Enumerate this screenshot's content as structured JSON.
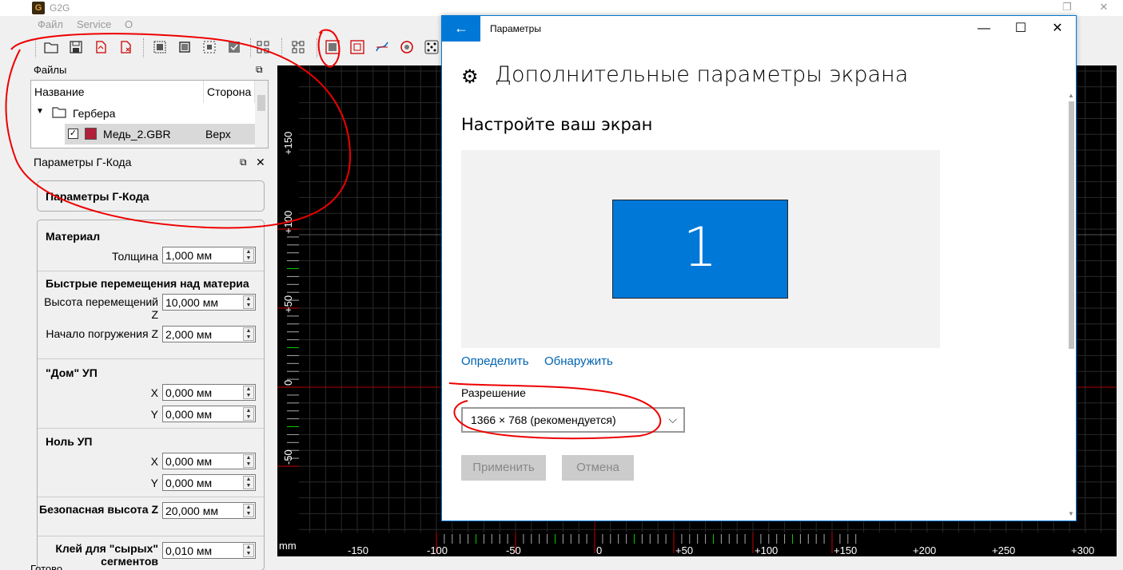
{
  "g2g": {
    "title": "G2G",
    "menu": [
      "Файл",
      "Service",
      "O"
    ],
    "files_panel": {
      "title": "Файлы",
      "col_name": "Название",
      "col_side": "Сторона",
      "folder": "Гербера",
      "file_name": "Медь_2.GBR",
      "file_side": "Верх",
      "file_color": "#b0203a"
    },
    "gcode_panel": {
      "title": "Параметры Г-Кода",
      "header": "Параметры Г-Кода",
      "material_title": "Материал",
      "thickness_label": "Толщина",
      "thickness_value": "1,000 мм",
      "rapid_title": "Быстрые перемещения над материа",
      "rapid_height_label": "Высота перемещений Z",
      "rapid_height_value": "10,000 мм",
      "plunge_label": "Начало погружения Z",
      "plunge_value": "2,000 мм",
      "home_title": "\"Дом\" УП",
      "home_x_label": "X",
      "home_x_value": "0,000 мм",
      "home_y_label": "Y",
      "home_y_value": "0,000 мм",
      "zero_title": "Ноль УП",
      "zero_x_label": "X",
      "zero_x_value": "0,000 мм",
      "zero_y_label": "Y",
      "zero_y_value": "0,000 мм",
      "safe_label": "Безопасная высота Z",
      "safe_value": "20,000 мм",
      "glue_label": "Клей для \"сырых\" сегментов",
      "glue_value": "0,010 мм"
    },
    "status": "Готово",
    "canvas": {
      "unit": "mm",
      "x_ticks": [
        "-150",
        "-100",
        "-50",
        "0",
        "+50",
        "+100",
        "+150",
        "+200",
        "+250",
        "+300"
      ],
      "y_ticks": [
        "+150",
        "+100",
        "+50",
        "0",
        "-50"
      ]
    }
  },
  "settings": {
    "window_title": "Параметры",
    "heading": "Дополнительные параметры экрана",
    "subheading": "Настройте ваш экран",
    "monitor_number": "1",
    "identify_link": "Определить",
    "detect_link": "Обнаружить",
    "resolution_label": "Разрешение",
    "resolution_value": "1366 × 768 (рекомендуется)",
    "apply_button": "Применить",
    "cancel_button": "Отмена",
    "accent_color": "#0078d7"
  }
}
